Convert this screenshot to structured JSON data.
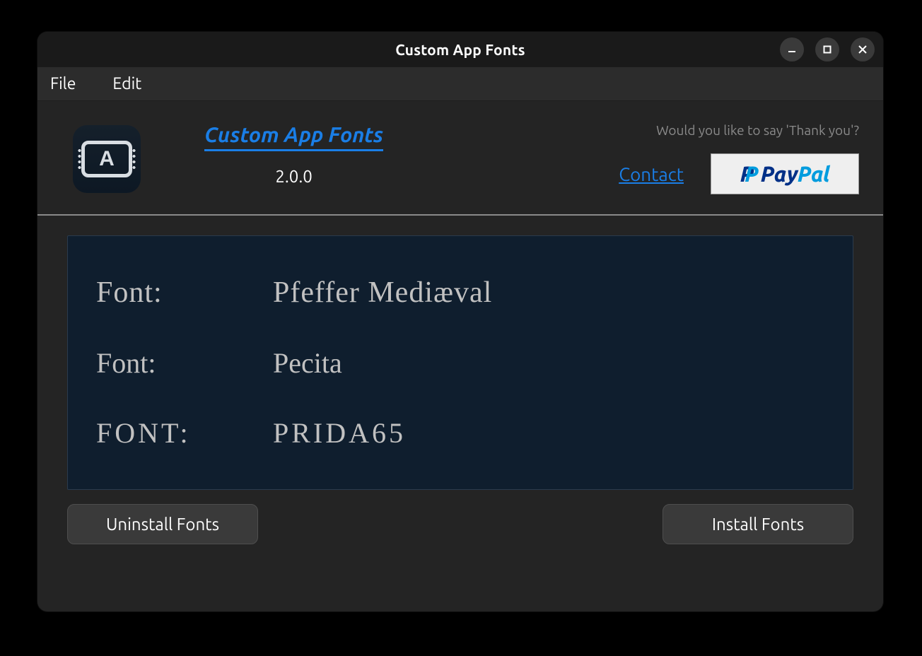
{
  "window": {
    "title": "Custom App Fonts"
  },
  "menu": {
    "file": "File",
    "edit": "Edit"
  },
  "header": {
    "app_icon_letter": "A",
    "title": "Custom App Fonts",
    "version": "2.0.0",
    "thanks": "Would you like to say 'Thank you'?",
    "contact": "Contact",
    "paypal_pay": "Pay",
    "paypal_pal": "Pal"
  },
  "fonts": [
    {
      "label": "Font:",
      "name": "Pfeffer Mediæval"
    },
    {
      "label": "Font:",
      "name": "Pecita"
    },
    {
      "label": "FONT:",
      "name": "PRIDA65"
    }
  ],
  "buttons": {
    "uninstall": "Uninstall Fonts",
    "install": "Install Fonts"
  }
}
